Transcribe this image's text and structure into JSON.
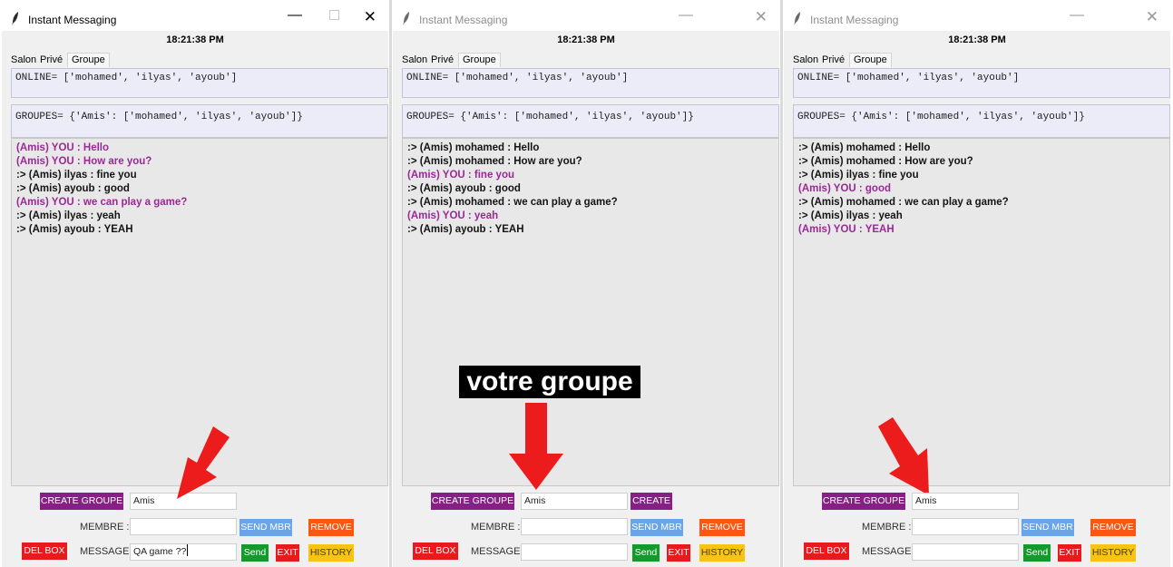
{
  "app_title": "Instant Messaging",
  "clock": "18:21:38 PM",
  "tabs": [
    "Salon",
    "Privé",
    "Groupe"
  ],
  "active_tab": "Groupe",
  "online_text": "ONLINE= ['mohamed', 'ilyas', 'ayoub']",
  "groupes_text": "GROUPES= {'Amis': ['mohamed', 'ilyas', 'ayoub']}",
  "labels": {
    "create_groupe": "CREATE GROUPE",
    "create": "CREATE",
    "membre": "MEMBRE :",
    "message": "MESSAGE :",
    "send_mbr": "SEND MBR",
    "remove": "REMOVE",
    "del_box": "DEL BOX",
    "send": "Send",
    "exit": "EXIT",
    "history": "HISTORY"
  },
  "colors": {
    "self_message": "#9a2896",
    "create_button": "#881f84",
    "send_mbr_button": "#6aa5ea",
    "remove_button": "#fa5711",
    "del_box_button": "#e71b1b",
    "send_button": "#129a2c",
    "exit_button": "#e71b1b",
    "history_button": "#f7c411",
    "annotation_arrow": "#ec1c1c"
  },
  "windows": [
    {
      "state": "active",
      "groupe_input": "Amis",
      "membre_input": "",
      "message_input": "QA game ??",
      "messages": [
        {
          "text": "(Amis) YOU : Hello",
          "self": true
        },
        {
          "text": "(Amis) YOU : How are you?",
          "self": true
        },
        {
          "text": ":> (Amis) ilyas : fine you",
          "self": false
        },
        {
          "text": ":> (Amis) ayoub : good",
          "self": false
        },
        {
          "text": "(Amis) YOU : we can play a game?",
          "self": true
        },
        {
          "text": ":> (Amis) ilyas : yeah",
          "self": false
        },
        {
          "text": ":> (Amis) ayoub : YEAH",
          "self": false
        }
      ]
    },
    {
      "state": "inactive",
      "groupe_input": "Amis",
      "membre_input": "",
      "message_input": "",
      "messages": [
        {
          "text": ":> (Amis) mohamed : Hello",
          "self": false
        },
        {
          "text": ":> (Amis) mohamed : How are you?",
          "self": false
        },
        {
          "text": "(Amis) YOU : fine you",
          "self": true
        },
        {
          "text": ":> (Amis) ayoub : good",
          "self": false
        },
        {
          "text": ":> (Amis) mohamed : we can play a game?",
          "self": false
        },
        {
          "text": "(Amis) YOU : yeah",
          "self": true
        },
        {
          "text": ":> (Amis) ayoub : YEAH",
          "self": false
        }
      ]
    },
    {
      "state": "inactive",
      "groupe_input": "Amis",
      "membre_input": "",
      "message_input": "",
      "messages": [
        {
          "text": ":> (Amis) mohamed : Hello",
          "self": false
        },
        {
          "text": ":> (Amis) mohamed : How are you?",
          "self": false
        },
        {
          "text": ":> (Amis) ilyas : fine you",
          "self": false
        },
        {
          "text": "(Amis) YOU : good",
          "self": true
        },
        {
          "text": ":> (Amis) mohamed : we can play a game?",
          "self": false
        },
        {
          "text": ":> (Amis) ilyas : yeah",
          "self": false
        },
        {
          "text": "(Amis) YOU : YEAH",
          "self": true
        }
      ]
    }
  ],
  "annotation_caption": "votre groupe"
}
